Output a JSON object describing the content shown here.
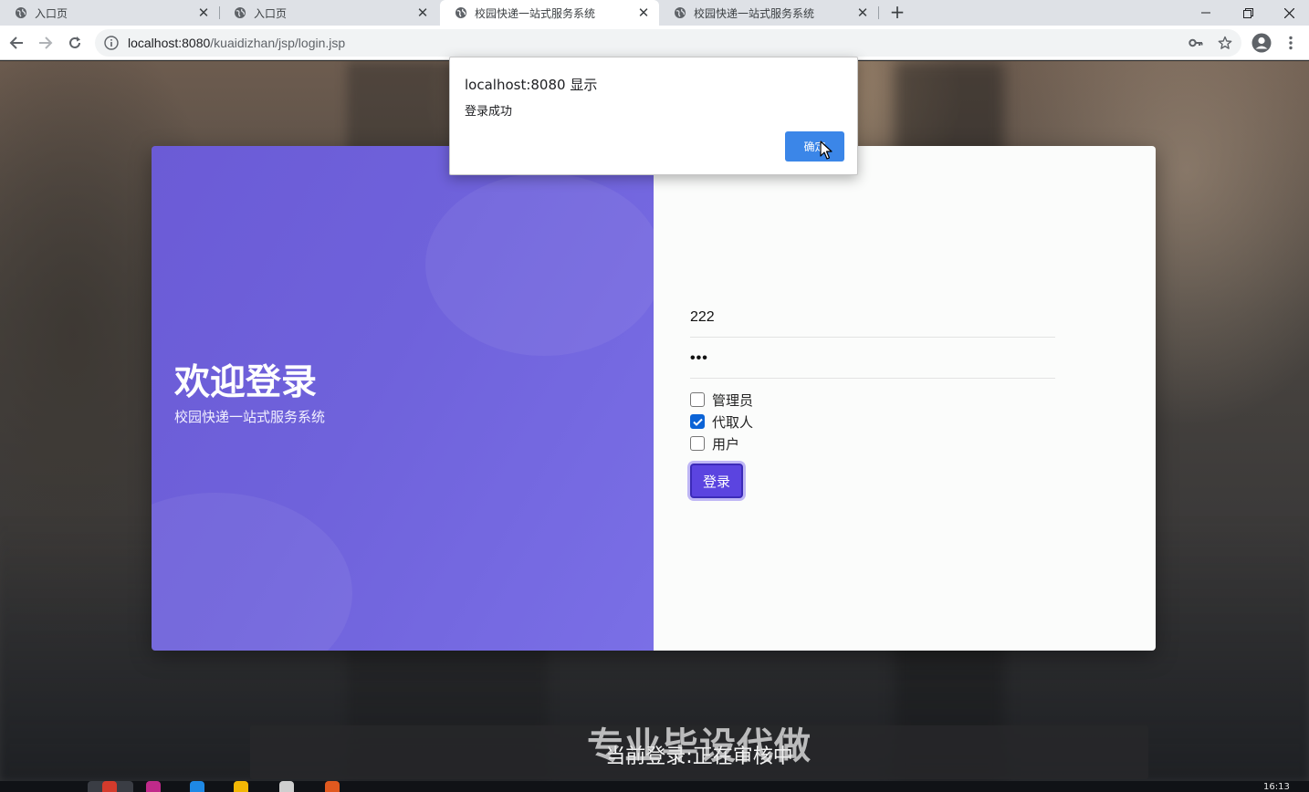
{
  "browser": {
    "tabs": [
      {
        "label": "入口页"
      },
      {
        "label": "入口页"
      },
      {
        "label": "校园快递一站式服务系统"
      },
      {
        "label": "校园快递一站式服务系统"
      }
    ],
    "url_host": "localhost:8080",
    "url_path": "/kuaidizhan/jsp/login.jsp",
    "new_tab_label": "+",
    "icons": [
      "back-icon",
      "forward-icon",
      "reload-icon",
      "info-icon",
      "key-icon",
      "star-icon",
      "account-icon",
      "menu-icon"
    ]
  },
  "login": {
    "welcome": "欢迎登录",
    "subtitle": "校园快递一站式服务系统",
    "username_value": "222",
    "password_value": "•••",
    "roles": [
      {
        "label": "管理员",
        "checked": false
      },
      {
        "label": "代取人",
        "checked": true
      },
      {
        "label": "用户",
        "checked": false
      }
    ],
    "login_button": "登录"
  },
  "alert": {
    "title": "localhost:8080 显示",
    "message": "登录成功",
    "ok_button": "确定"
  },
  "caption": {
    "line1": "专业毕设代做",
    "line2": "当前登录:正在审核中"
  },
  "taskbar": {
    "clock": "16:13"
  },
  "colors": {
    "brand_purple": "#6f62db",
    "login_button": "#5b44e0",
    "alert_button": "#3b86e8",
    "checkbox_checked": "#0b63d6"
  }
}
